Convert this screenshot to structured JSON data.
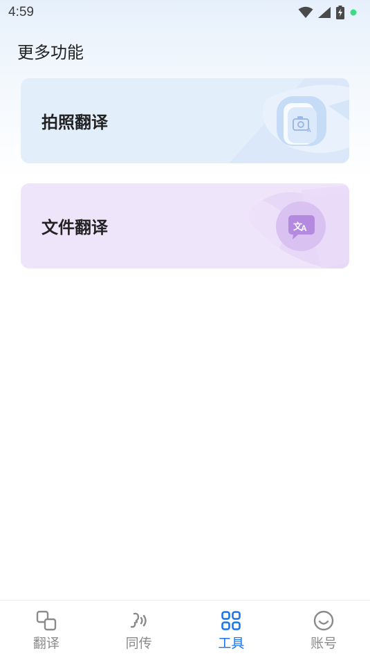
{
  "status_bar": {
    "time": "4:59",
    "icons": [
      "wifi-icon",
      "signal-icon",
      "battery-charging-icon",
      "notification-dot-icon"
    ]
  },
  "page": {
    "title": "更多功能"
  },
  "cards": [
    {
      "label": "拍照翻译",
      "icon": "camera-translate-icon",
      "color": "#e3eefb"
    },
    {
      "label": "文件翻译",
      "icon": "file-translate-icon",
      "color": "#efe5fa"
    }
  ],
  "bottom_nav": {
    "active_color": "#1a73e8",
    "items": [
      {
        "label": "翻译",
        "icon": "translate-icon",
        "active": false
      },
      {
        "label": "同传",
        "icon": "interpretation-icon",
        "active": false
      },
      {
        "label": "工具",
        "icon": "tools-grid-icon",
        "active": true
      },
      {
        "label": "账号",
        "icon": "account-smile-icon",
        "active": false
      }
    ]
  }
}
